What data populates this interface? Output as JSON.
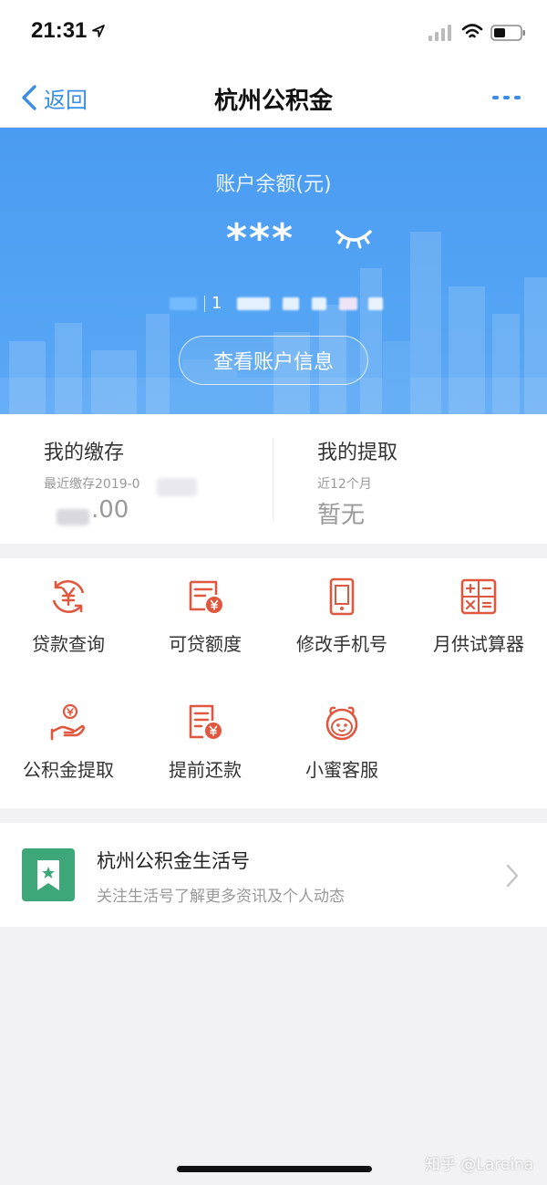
{
  "status_bar": {
    "time": "21:31"
  },
  "nav": {
    "back_label": "返回",
    "title": "杭州公积金"
  },
  "hero": {
    "balance_label": "账户余额(元)",
    "balance_masked": "***",
    "account_visible_digit": "1",
    "button_label": "查看账户信息"
  },
  "stats": {
    "deposit": {
      "title": "我的缴存",
      "subtitle": "最近缴存2019-0",
      "value": ".00"
    },
    "withdraw": {
      "title": "我的提取",
      "subtitle": "近12个月",
      "value": "暂无"
    }
  },
  "services": [
    {
      "label": "贷款查询",
      "icon": "yuan-refresh-icon"
    },
    {
      "label": "可贷额度",
      "icon": "receipt-yuan-icon"
    },
    {
      "label": "修改手机号",
      "icon": "phone-icon"
    },
    {
      "label": "月供试算器",
      "icon": "calculator-icon"
    },
    {
      "label": "公积金提取",
      "icon": "hand-coin-icon"
    },
    {
      "label": "提前还款",
      "icon": "bill-yuan-icon"
    },
    {
      "label": "小蜜客服",
      "icon": "assistant-face-icon"
    }
  ],
  "life_account": {
    "title": "杭州公积金生活号",
    "subtitle": "关注生活号了解更多资讯及个人动态"
  },
  "watermark": "知乎 @Lareina",
  "colors": {
    "accent_blue": "#3a8ee6",
    "hero_blue": "#4a9cf2",
    "icon_red": "#e0573f",
    "life_green": "#3ea77a"
  }
}
